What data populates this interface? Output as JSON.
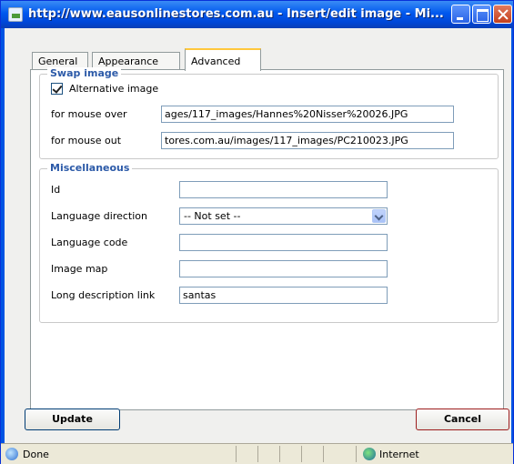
{
  "window": {
    "title": "http://www.eausonlinestores.com.au - Insert/edit image - Mi..."
  },
  "tabs": [
    {
      "label": "General"
    },
    {
      "label": "Appearance"
    },
    {
      "label": "Advanced"
    }
  ],
  "swap": {
    "legend": "Swap image",
    "alt_label": "Alternative image",
    "alt_checked": true,
    "mouse_over_label": "for mouse over",
    "mouse_over_value": "ages/117_images/Hannes%20Nisser%20026.JPG",
    "mouse_out_label": "for mouse out",
    "mouse_out_value": "tores.com.au/images/117_images/PC210023.JPG"
  },
  "misc": {
    "legend": "Miscellaneous",
    "id_label": "Id",
    "id_value": "",
    "dir_label": "Language direction",
    "dir_value": "-- Not set --",
    "code_label": "Language code",
    "code_value": "",
    "map_label": "Image map",
    "map_value": "",
    "longdesc_label": "Long description link",
    "longdesc_value": "santas"
  },
  "buttons": {
    "update": "Update",
    "cancel": "Cancel"
  },
  "status": {
    "text": "Done",
    "zone": "Internet"
  }
}
